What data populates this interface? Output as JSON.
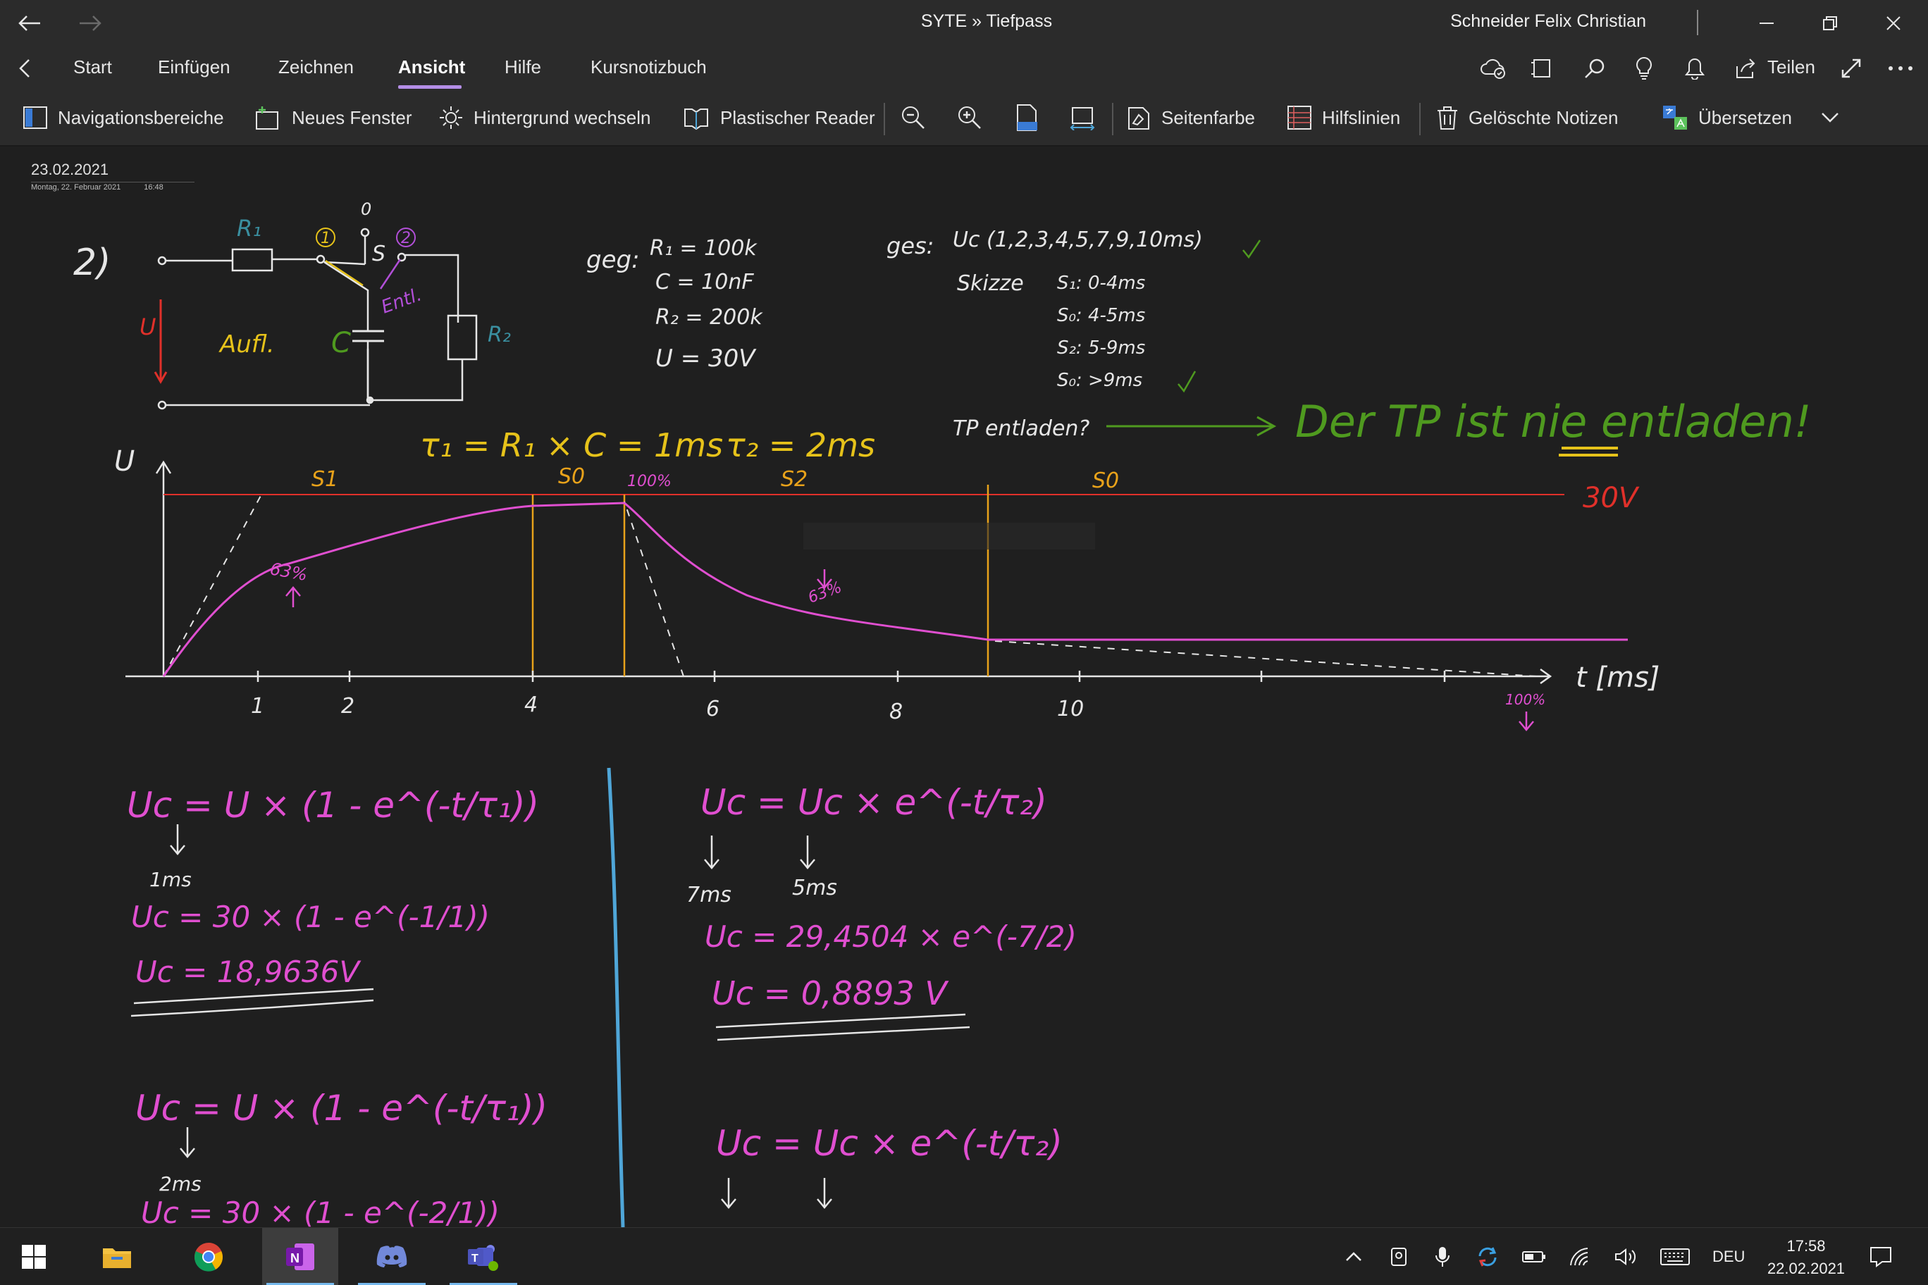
{
  "window": {
    "title": "SYTE » Tiefpass",
    "user": "Schneider Felix Christian"
  },
  "tabs": [
    {
      "label": "Start"
    },
    {
      "label": "Einfügen"
    },
    {
      "label": "Zeichnen"
    },
    {
      "label": "Ansicht",
      "active": true
    },
    {
      "label": "Hilfe"
    },
    {
      "label": "Kursnotizbuch"
    }
  ],
  "share_label": "Teilen",
  "ribbon": {
    "nav": "Navigationsbereiche",
    "new_window": "Neues Fenster",
    "bg": "Hintergrund wechseln",
    "reader": "Plastischer Reader",
    "page_color": "Seitenfarbe",
    "rule_lines": "Hilfslinien",
    "deleted": "Gelöschte Notizen",
    "translate": "Übersetzen"
  },
  "page": {
    "date": "23.02.2021",
    "meta_date": "Montag, 22. Februar 2021",
    "meta_time": "16:48"
  },
  "notes": {
    "task": "2)",
    "given_label": "geg:",
    "given": [
      "R₁ = 100k",
      "C = 10nF",
      "R₂ = 200k",
      "U = 30V"
    ],
    "sought_label": "ges:",
    "sought": "Uc (1,2,3,4,5,7,9,10ms)",
    "sketch_label": "Skizze",
    "phases": [
      "S₁: 0-4ms",
      "S₀: 4-5ms",
      "S₂: 5-9ms",
      "S₀: >9ms"
    ],
    "question": "TP entladen?",
    "conclusion": "Der TP ist nie entladen!",
    "circuit_R1": "R₁",
    "circuit_R2": "R₂",
    "circuit_C": "C",
    "circuit_U": "U",
    "circuit_S": "S",
    "circuit_0": "0",
    "circuit_1": "1",
    "circuit_2": "2",
    "circuit_charge": "Aufl.",
    "circuit_discharge": "Entl.",
    "taus": "τ₁ = R₁ × C = 1ms",
    "tau2": "τ₂ = 2ms",
    "graph_y": "U",
    "graph_x": "t [ms]",
    "graph_ref": "30V",
    "graph_phases": [
      "S1",
      "S0",
      "S2",
      "S0"
    ],
    "graph_pct": [
      "63%",
      "100%",
      "63%",
      "100%"
    ],
    "graph_ticks": [
      "1",
      "2",
      "4",
      "6",
      "8",
      "10"
    ],
    "f1": "Uc = U × (1 - e^(-t/τ₁))",
    "f1_t": "1ms",
    "f1_sub": "Uc = 30 × (1 - e^(-1/1))",
    "f1_res": "Uc = 18,9636V",
    "f2": "Uc = U × (1 - e^(-t/τ₁))",
    "f2_t": "2ms",
    "f2_sub": "Uc = 30 × (1 - e^(-2/1))",
    "f3": "Uc = Uc × e^(-t/τ₂)",
    "f3_t1": "7ms",
    "f3_t2": "5ms",
    "f3_sub": "Uc = 29,4504 × e^(-7/2)",
    "f3_res": "Uc = 0,8893 V",
    "f4": "Uc = Uc × e^(-t/τ₂)"
  },
  "taskbar": {
    "lang": "DEU",
    "time": "17:58",
    "date": "22.02.2021"
  },
  "colors": {
    "pink": "#e04fd0",
    "red": "#e0302a",
    "green": "#4f9a1f",
    "yellow": "#e6c21a",
    "teal": "#3a8fa0",
    "orange": "#e8a21a",
    "blue_divider": "#4fa6d8"
  }
}
